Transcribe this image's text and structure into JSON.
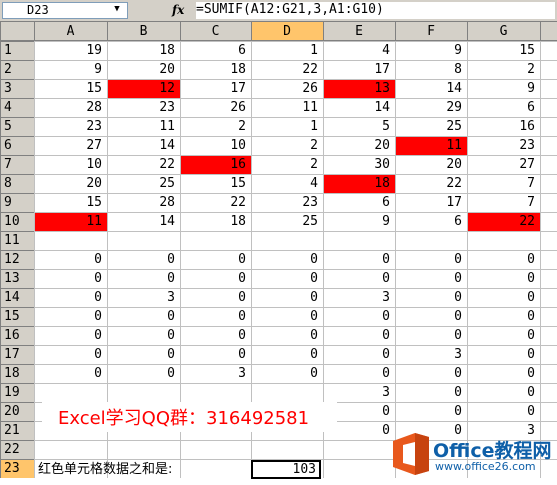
{
  "namebox": "D23",
  "formula": "=SUMIF(A12:G21,3,A1:G10)",
  "fx_label": "fx",
  "columns": [
    "A",
    "B",
    "C",
    "D",
    "E",
    "F",
    "G"
  ],
  "selected_column": "D",
  "row_numbers": [
    "1",
    "2",
    "3",
    "4",
    "5",
    "6",
    "7",
    "8",
    "9",
    "10",
    "11",
    "12",
    "13",
    "14",
    "15",
    "16",
    "17",
    "18",
    "19",
    "20",
    "21",
    "22",
    "23"
  ],
  "rows": [
    [
      "19",
      "18",
      "6",
      "1",
      "4",
      "9",
      "15"
    ],
    [
      "9",
      "20",
      "18",
      "22",
      "17",
      "8",
      "2"
    ],
    [
      "15",
      "12",
      "17",
      "26",
      "13",
      "14",
      "9"
    ],
    [
      "28",
      "23",
      "26",
      "11",
      "14",
      "29",
      "6"
    ],
    [
      "23",
      "11",
      "2",
      "1",
      "5",
      "25",
      "16"
    ],
    [
      "27",
      "14",
      "10",
      "2",
      "20",
      "11",
      "23"
    ],
    [
      "10",
      "22",
      "16",
      "2",
      "30",
      "20",
      "27"
    ],
    [
      "20",
      "25",
      "15",
      "4",
      "18",
      "22",
      "7"
    ],
    [
      "15",
      "28",
      "22",
      "23",
      "6",
      "17",
      "7"
    ],
    [
      "11",
      "14",
      "18",
      "25",
      "9",
      "6",
      "22"
    ],
    [
      "",
      "",
      "",
      "",
      "",
      "",
      ""
    ],
    [
      "0",
      "0",
      "0",
      "0",
      "0",
      "0",
      "0"
    ],
    [
      "0",
      "0",
      "0",
      "0",
      "0",
      "0",
      "0"
    ],
    [
      "0",
      "3",
      "0",
      "0",
      "3",
      "0",
      "0"
    ],
    [
      "0",
      "0",
      "0",
      "0",
      "0",
      "0",
      "0"
    ],
    [
      "0",
      "0",
      "0",
      "0",
      "0",
      "0",
      "0"
    ],
    [
      "0",
      "0",
      "0",
      "0",
      "0",
      "3",
      "0"
    ],
    [
      "0",
      "0",
      "3",
      "0",
      "0",
      "0",
      "0"
    ],
    [
      "",
      "",
      "",
      "",
      "3",
      "0",
      "0"
    ],
    [
      "",
      "",
      "",
      "",
      "0",
      "0",
      "0"
    ],
    [
      "",
      "",
      "",
      "",
      "0",
      "0",
      "3"
    ],
    [
      "",
      "",
      "",
      "",
      "",
      "",
      ""
    ],
    [
      "",
      "",
      "",
      "",
      "",
      "",
      ""
    ]
  ],
  "red_cells": [
    [
      2,
      1
    ],
    [
      2,
      4
    ],
    [
      5,
      5
    ],
    [
      6,
      2
    ],
    [
      7,
      4
    ],
    [
      9,
      0
    ],
    [
      9,
      6
    ]
  ],
  "highlight_color": "#ff0000",
  "watermark_text": "Excel学习QQ群：316492581",
  "sum_label": "红色单元格数据之和是:",
  "sum_value": "103",
  "logo": {
    "main": "Office教程网",
    "url": "www.office26.com"
  }
}
